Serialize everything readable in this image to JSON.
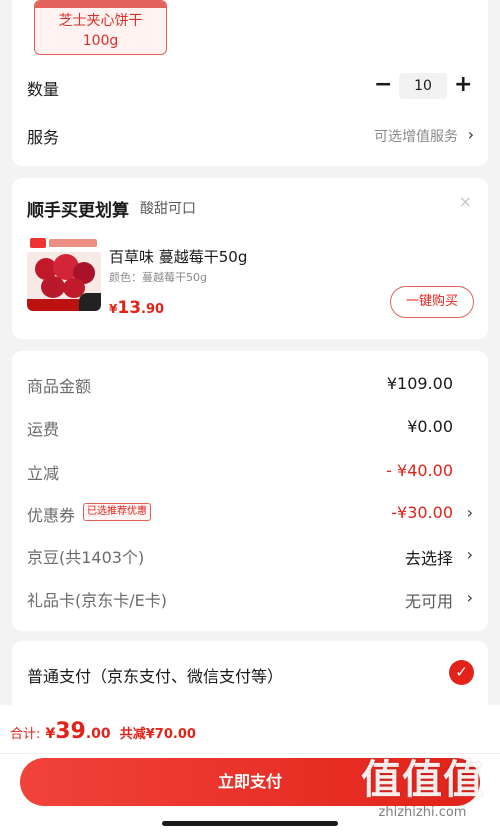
{
  "product": {
    "variant_name": "芝士夹心饼干",
    "variant_size": "100g",
    "quantity_label": "数量",
    "quantity_value": "10",
    "quantity_minus": "−",
    "quantity_plus": "+",
    "service_label": "服务",
    "service_value": "可选增值服务"
  },
  "upsell": {
    "title": "顺手买更划算",
    "subtitle": "酸甜可口",
    "close": "×",
    "item": {
      "name": "百草味 蔓越莓干50g",
      "color": "颜色：蔓越莓干50g",
      "price_symbol": "¥",
      "price_int": "13",
      "price_dec": ".90",
      "buy_label": "一键购买"
    }
  },
  "summary": {
    "rows": [
      {
        "label": "商品金额",
        "value": "¥109.00"
      },
      {
        "label": "运费",
        "value": "¥0.00"
      },
      {
        "label": "立减",
        "value": "- ¥40.00"
      },
      {
        "label": "优惠券",
        "tag": "已选推荐优惠",
        "value": "-¥30.00"
      },
      {
        "label": "京豆(共1403个)",
        "value": "去选择"
      },
      {
        "label": "礼品卡(京东卡/E卡)",
        "value": "无可用"
      }
    ]
  },
  "payment": {
    "method": "普通支付（京东支付、微信支付等）",
    "check": "✓"
  },
  "footer": {
    "total_label": "合计:",
    "total_symbol": "¥",
    "total_int": "39",
    "total_dec": ".00",
    "saving": "共减¥70.00",
    "pay_button": "立即支付"
  },
  "watermark": {
    "main": "值值值",
    "url": "zhizhizhi.com"
  },
  "icons": {
    "chevron": "chevron-right-icon",
    "check": "check-circle-icon",
    "close": "close-icon"
  },
  "colors": {
    "accent": "#e2231a",
    "background": "#f3f3f3",
    "card": "#ffffff",
    "muted": "#8c8c8c"
  }
}
